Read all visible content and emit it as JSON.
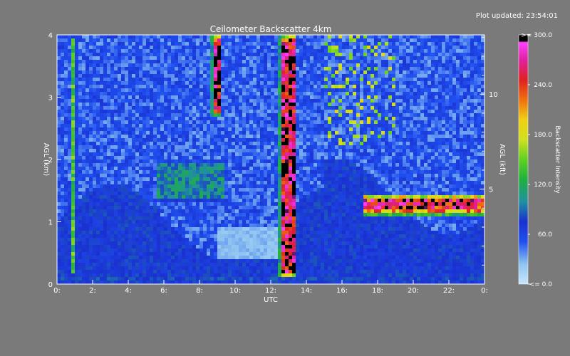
{
  "header": {
    "updated_label": "Plot updated: 23:54:01"
  },
  "chart_data": {
    "type": "heatmap",
    "title": "Ceilometer Backscatter 4km",
    "xlabel": "UTC",
    "ylabel_left": "AGL (km)",
    "ylabel_right": "AGL (kft)",
    "colorbar_label": "Backscatter Intensity",
    "x_range_hours": [
      0,
      24
    ],
    "y_range_km": [
      0,
      4
    ],
    "y_range_kft": [
      0,
      13.12
    ],
    "x_ticks": [
      "0:",
      "2:",
      "4:",
      "6:",
      "8:",
      "10:",
      "12:",
      "14:",
      "16:",
      "18:",
      "20:",
      "22:",
      "0:"
    ],
    "y_ticks_left": [
      "0",
      "1",
      "2",
      "3",
      "4"
    ],
    "y_ticks_right": [
      "5",
      "10"
    ],
    "colorbar_ticks": [
      ">= 300.0",
      "240.0",
      "180.0",
      "120.0",
      "60.0",
      "<= 0.0"
    ],
    "colorbar_range": [
      0,
      300
    ],
    "colors": {
      "background": "#7a7a7a",
      "clear_air": "#9cc8ee",
      "boundary_layer": "#1a3fe0",
      "aerosol_green": "#30c040",
      "cloud_high": "#d02020",
      "saturated": "#000000"
    },
    "features": [
      {
        "name": "fog/precip column",
        "start_hour": 0.8,
        "end_hour": 1.1,
        "base_km": 0.1,
        "top_km": 4.0,
        "intensity": 150
      },
      {
        "name": "aerosol layer",
        "start_hour": 5.5,
        "end_hour": 9.5,
        "base_km": 1.3,
        "top_km": 2.0,
        "intensity": 110
      },
      {
        "name": "precip streak",
        "start_hour": 8.7,
        "end_hour": 9.2,
        "base_km": 2.7,
        "top_km": 4.0,
        "intensity": 300
      },
      {
        "name": "cloud/rain column",
        "start_hour": 12.5,
        "end_hour": 13.4,
        "base_km": 0.1,
        "top_km": 4.0,
        "intensity": 300
      },
      {
        "name": "cloud base layer",
        "start_hour": 17.2,
        "end_hour": 24.0,
        "base_km": 1.1,
        "top_km": 1.45,
        "intensity": 280
      },
      {
        "name": "surface layer",
        "start_hour": 0.0,
        "end_hour": 24.0,
        "base_km": 0.0,
        "top_km": 0.2,
        "intensity": 90
      }
    ]
  }
}
